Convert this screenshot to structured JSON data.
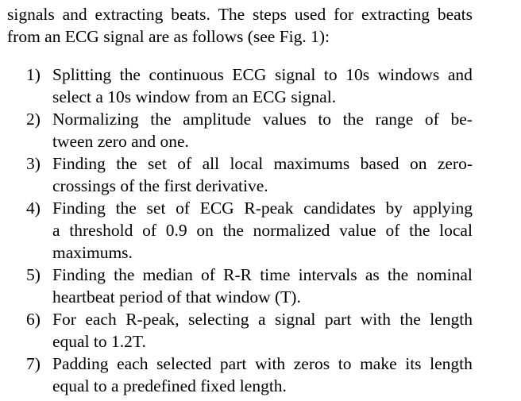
{
  "intro": {
    "line1": "signals and extracting beats. The steps used for extracting beats",
    "line2": "from an ECG signal are as follows (see Fig. 1):"
  },
  "steps": [
    {
      "number": "1)",
      "lines": [
        "Splitting the continuous ECG signal to 10s windows and",
        "select a 10s window from an ECG signal."
      ]
    },
    {
      "number": "2)",
      "lines": [
        "Normalizing the amplitude values to the range of be-",
        "tween zero and one."
      ]
    },
    {
      "number": "3)",
      "lines": [
        "Finding the set of all local maximums based on zero-",
        "crossings of the first derivative."
      ]
    },
    {
      "number": "4)",
      "lines": [
        "Finding the set of ECG R-peak candidates by applying",
        "a threshold of 0.9 on the normalized value of the local",
        "maximums."
      ]
    },
    {
      "number": "5)",
      "lines": [
        "Finding the median of R-R time intervals as the nominal",
        "heartbeat period of that window (T)."
      ]
    },
    {
      "number": "6)",
      "lines": [
        "For each R-peak, selecting a signal part with the length",
        "equal to 1.2T."
      ]
    },
    {
      "number": "7)",
      "lines": [
        "Padding each selected part with zeros to make its length",
        "equal to a predefined fixed length."
      ]
    }
  ]
}
